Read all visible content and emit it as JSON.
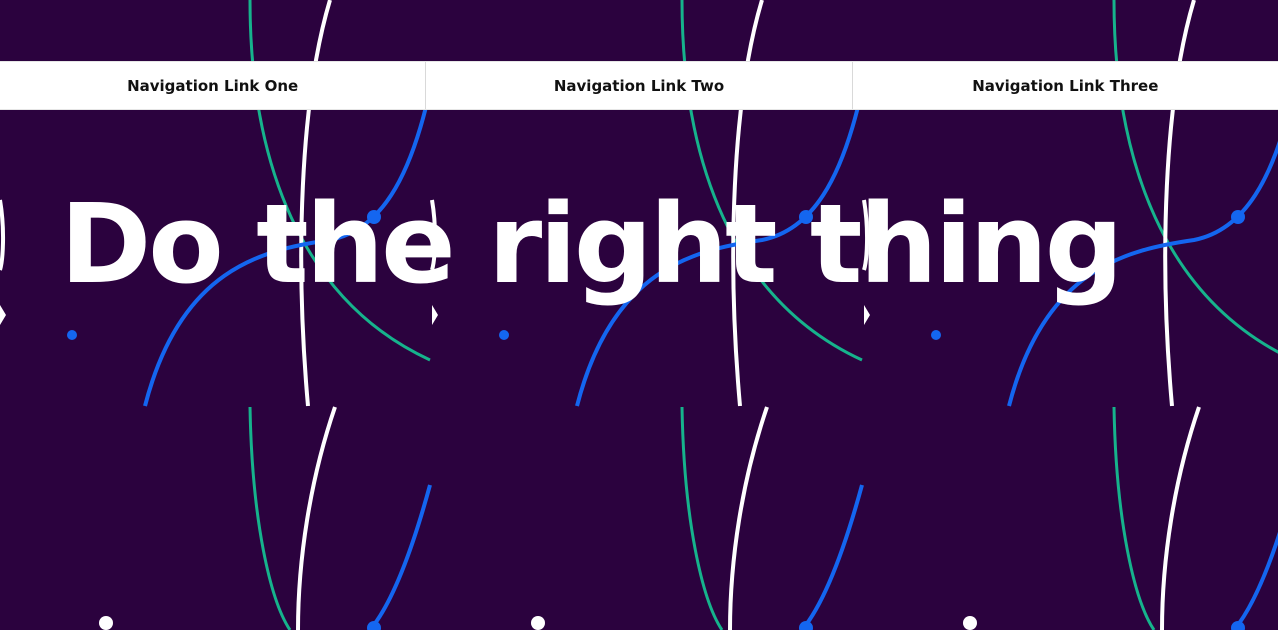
{
  "nav": {
    "links": [
      {
        "label": "Navigation Link One"
      },
      {
        "label": "Navigation Link Two"
      },
      {
        "label": "Navigation Link Three"
      }
    ]
  },
  "hero": {
    "title": "Do the right thing"
  },
  "colors": {
    "background": "#2b023e",
    "nav_background": "#ffffff",
    "nav_text": "#111111",
    "title": "#ffffff",
    "pattern_teal": "#16b38c",
    "pattern_blue": "#1466f0",
    "pattern_white": "#ffffff"
  }
}
